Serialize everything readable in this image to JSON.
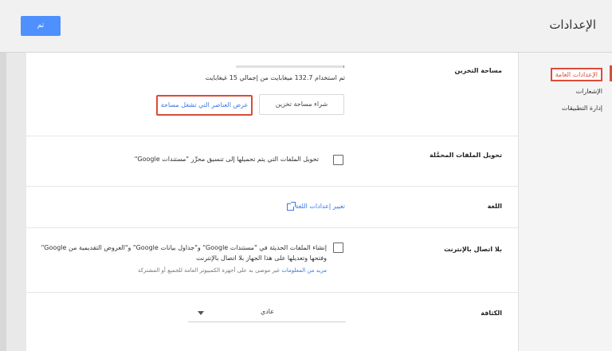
{
  "header": {
    "title": "الإعدادات",
    "done_label": "تم"
  },
  "nav": {
    "items": [
      {
        "label": "الإعدادات العامة",
        "active": true
      },
      {
        "label": "الإشعارات",
        "active": false
      },
      {
        "label": "إدارة التطبيقات",
        "active": false
      }
    ]
  },
  "storage": {
    "label": "مساحة التخزين",
    "usage_text": "تم استخدام 132.7 ميغابايت من إجمالي 15 غيغابايت",
    "used_fraction": 0.009,
    "buy_button": "شراء مساحة تخزين",
    "view_items_button": "عرض العناصر التي تشغل مساحة"
  },
  "convert": {
    "label": "تحويل الملفات المحمَّلة",
    "checkbox_text": "تحويل الملفات التي يتم تحميلها إلى تنسيق محرِّر \"مستندات Google\"",
    "checked": false
  },
  "language": {
    "label": "اللغة",
    "link_text": "تغيير إعدادات اللغة"
  },
  "offline": {
    "label": "بلا اتصال بالإنترنت",
    "checkbox_line1": "إنشاء الملفات الحديثة في \"مستندات Google\" و\"جداول بيانات Google\" و\"العروض التقديمية من Google\"",
    "checkbox_line2": "وفتحها وتعديلها على هذا الجهاز بلا اتصال بالإنترنت",
    "note_text": "غير موصى به على أجهزة الكمبيوتر العامة للجميع أو المشتركة",
    "learn_more": "مزيد من المعلومات",
    "checked": false
  },
  "density": {
    "label": "الكثافة",
    "selected": "عادي"
  },
  "colors": {
    "accent_blue": "#4d90fe",
    "link_blue": "#3b78e7",
    "highlight_red": "#dd4b39"
  }
}
